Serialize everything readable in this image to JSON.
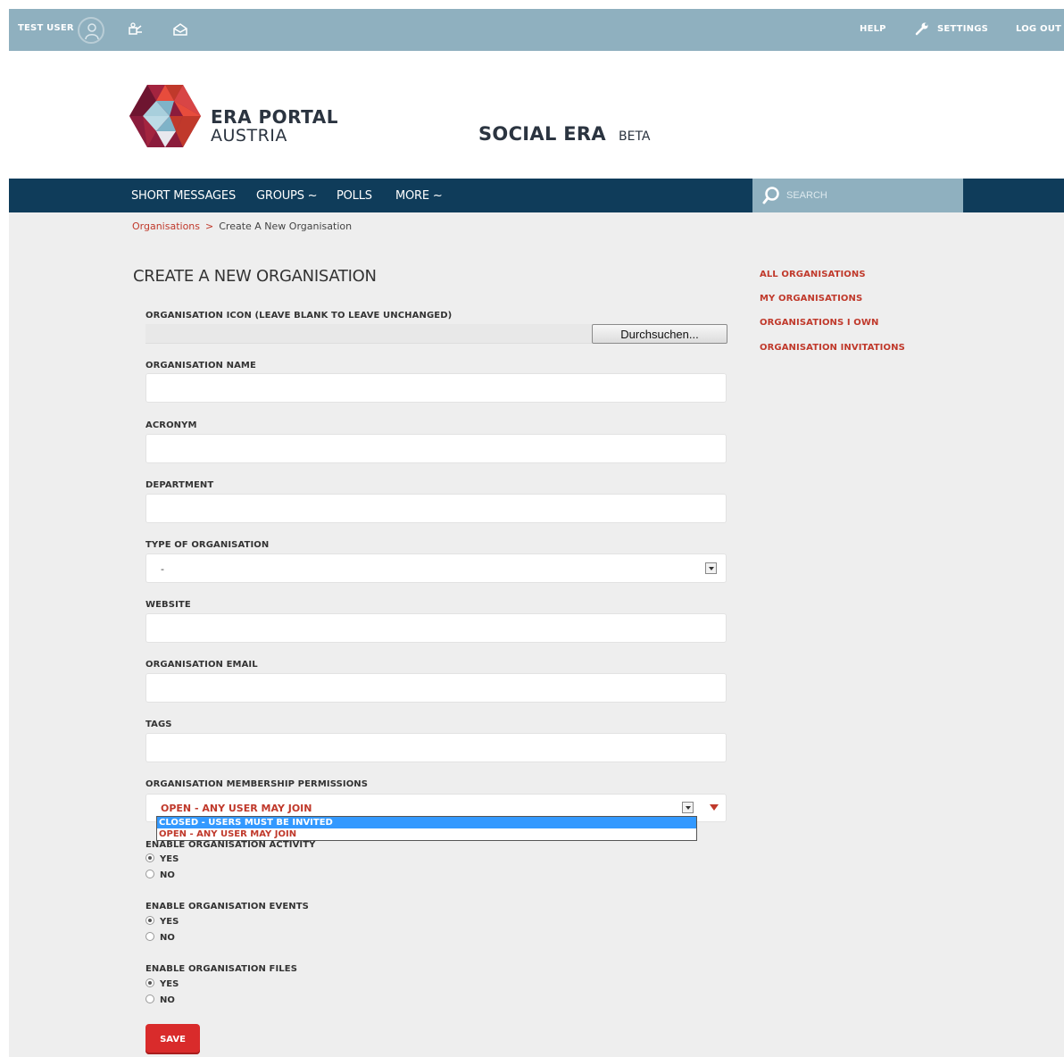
{
  "topbar": {
    "user": "TEST USER",
    "help": "HELP",
    "settings": "SETTINGS",
    "logout": "LOG OUT",
    "icons": [
      "avatar-icon",
      "notifications-icon",
      "messages-icon",
      "wrench-icon"
    ]
  },
  "header": {
    "brand_line1": "ERA PORTAL",
    "brand_line2": "AUSTRIA",
    "app_name": "SOCIAL ERA",
    "badge": "BETA",
    "logo_colors": [
      "#8b1c3c",
      "#c0392b",
      "#e74c3c",
      "#7fb3c8"
    ]
  },
  "nav": {
    "items": [
      "SHORT MESSAGES",
      "GROUPS ~",
      "POLLS",
      "MORE ~"
    ],
    "search_placeholder": "SEARCH"
  },
  "breadcrumb": {
    "parent": "Organisations",
    "separator": ">",
    "current": "Create A New Organisation"
  },
  "form": {
    "title": "CREATE A NEW ORGANISATION",
    "icon_label": "ORGANISATION ICON (LEAVE BLANK TO LEAVE UNCHANGED)",
    "browse_button": "Durchsuchen...",
    "name_label": "ORGANISATION NAME",
    "acronym_label": "ACRONYM",
    "department_label": "DEPARTMENT",
    "type_label": "TYPE OF ORGANISATION",
    "type_value": "-",
    "website_label": "WEBSITE",
    "email_label": "ORGANISATION EMAIL",
    "tags_label": "TAGS",
    "permissions_label": "ORGANISATION MEMBERSHIP PERMISSIONS",
    "permissions_value": "OPEN - ANY USER MAY JOIN",
    "permissions_options": [
      "CLOSED - USERS MUST BE INVITED",
      "OPEN - ANY USER MAY JOIN"
    ],
    "activity_label": "ENABLE ORGANISATION ACTIVITY",
    "events_label": "ENABLE ORGANISATION EVENTS",
    "files_label": "ENABLE ORGANISATION FILES",
    "yes": "YES",
    "no": "NO",
    "save": "SAVE"
  },
  "sidebar": {
    "links": [
      "ALL ORGANISATIONS",
      "MY ORGANISATIONS",
      "ORGANISATIONS I OWN",
      "ORGANISATION INVITATIONS"
    ]
  },
  "colors": {
    "topbar": "#8fb0bf",
    "navbar": "#0f3c5a",
    "accent": "#c0392b",
    "save": "#d92b2b"
  }
}
